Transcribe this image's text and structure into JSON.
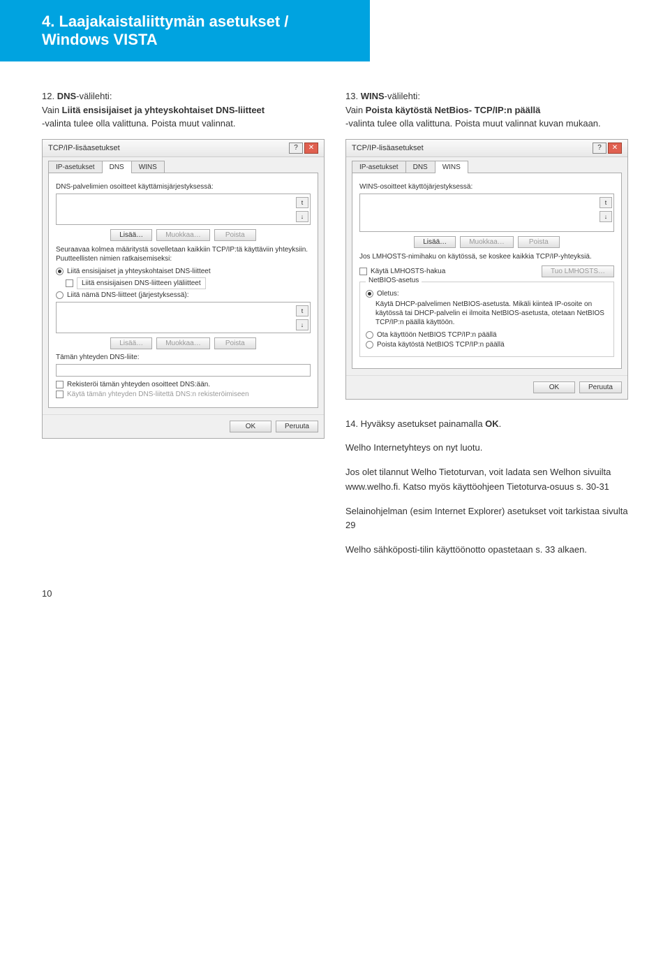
{
  "heading": "4. Laajakaistaliittymän asetukset / Windows VISTA",
  "left": {
    "step_num": "12. ",
    "step_label": "DNS",
    "step_tail": "-välilehti:",
    "step_line2a": "Vain ",
    "step_line2b": "Liitä ensisijaiset ja yhteyskohtaiset DNS-liitteet",
    "step_line3": "-valinta tulee olla valittuna. Poista muut valinnat.",
    "dialog": {
      "title": "TCP/IP-lisäasetukset",
      "tabs": [
        "IP-asetukset",
        "DNS",
        "WINS"
      ],
      "active_tab": 1,
      "lbl1": "DNS-palvelimien osoitteet käyttämisjärjestyksessä:",
      "btns1": [
        "Lisää…",
        "Muokkaa…",
        "Poista"
      ],
      "para": "Seuraavaa kolmea määritystä sovelletaan kaikkiin TCP/IP:tä käyttäviin yhteyksiin. Puutteellisten nimien ratkaisemiseksi:",
      "r1": "Liitä ensisijaiset ja yhteyskohtaiset DNS-liitteet",
      "c1": "Liitä ensisijaisen DNS-liitteen yläliitteet",
      "r2": "Liitä nämä DNS-liitteet (järjestyksessä):",
      "btns2": [
        "Lisää…",
        "Muokkaa…",
        "Poista"
      ],
      "lbl2": "Tämän yhteyden DNS-liite:",
      "c2": "Rekisteröi tämän yhteyden osoitteet DNS:ään.",
      "c3": "Käytä tämän yhteyden DNS-liitettä DNS:n rekisteröimiseen",
      "ok": "OK",
      "cancel": "Peruuta"
    }
  },
  "right": {
    "step_num": "13. ",
    "step_label": "WINS",
    "step_tail": "-välilehti:",
    "step_line2a": "Vain ",
    "step_line2b": "Poista käytöstä NetBios- TCP/IP:n päällä",
    "step_line3": " -valinta tulee olla valittuna. Poista muut valinnat kuvan mukaan.",
    "dialog": {
      "title": "TCP/IP-lisäasetukset",
      "tabs": [
        "IP-asetukset",
        "DNS",
        "WINS"
      ],
      "active_tab": 2,
      "lbl1": "WINS-osoitteet käyttöjärjestyksessä:",
      "btns1": [
        "Lisää…",
        "Muokkaa…",
        "Poista"
      ],
      "para": "Jos LMHOSTS-nimihaku on käytössä, se koskee kaikkia TCP/IP-yhteyksiä.",
      "c1": "Käytä LMHOSTS-hakua",
      "b_import": "Tuo LMHOSTS…",
      "group": "NetBIOS-asetus",
      "r1": "Oletus:",
      "r1_desc": "Käytä DHCP-palvelimen NetBIOS-asetusta. Mikäli kiinteä IP-osoite on käytössä tai DHCP-palvelin ei ilmoita NetBIOS-asetusta, otetaan NetBIOS TCP/IP:n päällä käyttöön.",
      "r2": "Ota käyttöön NetBIOS TCP/IP:n päällä",
      "r3": "Poista käytöstä NetBIOS TCP/IP:n päällä",
      "ok": "OK",
      "cancel": "Peruuta"
    },
    "follow": {
      "p1a": "14. Hyväksy asetukset painamalla ",
      "p1b": "OK",
      "p1c": ".",
      "p2": "Welho Internetyhteys on nyt luotu.",
      "p3": "Jos olet tilannut Welho Tietoturvan, voit ladata sen Welhon sivuilta www.welho.fi. Katso myös käyttöohjeen Tietoturva-osuus s. 30-31",
      "p4": "Selainohjelman (esim Internet Explorer) asetukset voit tarkistaa sivulta 29",
      "p5": "Welho sähköposti-tilin käyttöönotto opastetaan s. 33 alkaen."
    }
  },
  "page_number": "10"
}
